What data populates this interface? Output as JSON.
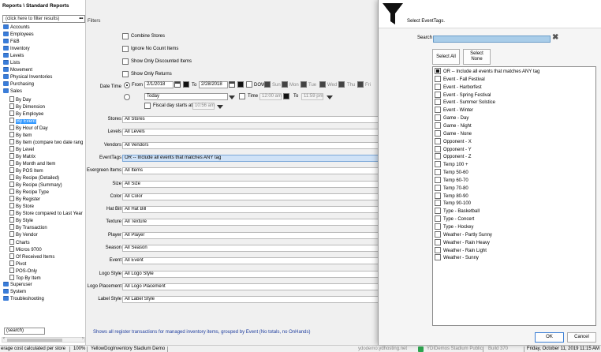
{
  "left_panel": {
    "breadcrumb": "Reports \\ Standard Reports",
    "filter_placeholder": "(click here to filter results)",
    "filter_more": "•••",
    "search_value": "(search)",
    "tree": [
      {
        "label": "Accounts",
        "type": "folder",
        "level": 0
      },
      {
        "label": "Employees",
        "type": "folder",
        "level": 0
      },
      {
        "label": "F&B",
        "type": "folder",
        "level": 0
      },
      {
        "label": "Inventory",
        "type": "folder",
        "level": 0
      },
      {
        "label": "Levels",
        "type": "folder",
        "level": 0
      },
      {
        "label": "Lists",
        "type": "folder",
        "level": 0
      },
      {
        "label": "Movement",
        "type": "folder",
        "level": 0
      },
      {
        "label": "Physical Inventories",
        "type": "folder",
        "level": 0
      },
      {
        "label": "Purchasing",
        "type": "folder",
        "level": 0
      },
      {
        "label": "Sales",
        "type": "folder",
        "level": 0
      },
      {
        "label": "By Day",
        "type": "doc",
        "level": 1
      },
      {
        "label": "By Dimension",
        "type": "doc",
        "level": 1
      },
      {
        "label": "By Employee",
        "type": "doc",
        "level": 1
      },
      {
        "label": "By Event",
        "type": "doc",
        "level": 1,
        "selected": true
      },
      {
        "label": "By Hour of Day",
        "type": "doc",
        "level": 1
      },
      {
        "label": "By Item",
        "type": "doc",
        "level": 1
      },
      {
        "label": "By Item (compare two date rang",
        "type": "doc",
        "level": 1
      },
      {
        "label": "By Level",
        "type": "doc",
        "level": 1
      },
      {
        "label": "By Matrix",
        "type": "doc",
        "level": 1
      },
      {
        "label": "By Month and Item",
        "type": "doc",
        "level": 1
      },
      {
        "label": "By POS Item",
        "type": "doc",
        "level": 1
      },
      {
        "label": "By Recipe (Detailed)",
        "type": "doc",
        "level": 1
      },
      {
        "label": "By Recipe (Summary)",
        "type": "doc",
        "level": 1
      },
      {
        "label": "By Recipe Type",
        "type": "doc",
        "level": 1
      },
      {
        "label": "By Register",
        "type": "doc",
        "level": 1
      },
      {
        "label": "By Store",
        "type": "doc",
        "level": 1
      },
      {
        "label": "By Store compared to Last Year",
        "type": "doc",
        "level": 1
      },
      {
        "label": "By Style",
        "type": "doc",
        "level": 1
      },
      {
        "label": "By Transaction",
        "type": "doc",
        "level": 1
      },
      {
        "label": "By Vendor",
        "type": "doc",
        "level": 1
      },
      {
        "label": "Charts",
        "type": "doc",
        "level": 1
      },
      {
        "label": "Micros 9700",
        "type": "doc",
        "level": 1
      },
      {
        "label": "Of Received Items",
        "type": "doc",
        "level": 1
      },
      {
        "label": "Pivot",
        "type": "doc",
        "level": 1
      },
      {
        "label": "POS-Only",
        "type": "doc",
        "level": 1
      },
      {
        "label": "Top By Item",
        "type": "doc",
        "level": 1
      },
      {
        "label": "Superuser",
        "type": "folder",
        "level": 0
      },
      {
        "label": "System",
        "type": "folder",
        "level": 0
      },
      {
        "label": "Troubleshooting",
        "type": "folder",
        "level": 0
      }
    ]
  },
  "filters": {
    "title": "Filters",
    "checkboxes": [
      "Combine Stores",
      "Ignore No Count Items",
      "Show Only Discounted Items",
      "Show Only Returns"
    ],
    "date_time_label": "Date Time",
    "from_label": "From",
    "from_date": "2/1/2018",
    "to_label": "To",
    "to_date": "2/28/2018",
    "dow_label": "DOW",
    "days": [
      "Sun",
      "Mon",
      "Tue",
      "Wed",
      "Thu",
      "Fri"
    ],
    "relative_value": "Today",
    "time_label": "Time",
    "time_from": "12:00 am",
    "time_to_label": "To",
    "time_to": "11:59 pm",
    "fiscal_label": "Fiscal day starts at",
    "fiscal_time": "10:56 am",
    "rows": [
      {
        "label": "Stores",
        "value": "All Stores"
      },
      {
        "label": "Levels",
        "value": "All Levels"
      },
      {
        "label": "Vendors",
        "value": "All Vendors"
      },
      {
        "label": "EventTags",
        "value": "OR -- Include all events that matches ANY tag",
        "highlight": true
      },
      {
        "label": "Evergreen Items",
        "value": "All Items"
      },
      {
        "label": "Size",
        "value": "All Size"
      },
      {
        "label": "Color",
        "value": "All Color"
      },
      {
        "label": "Hat Bill",
        "value": "All Hat Bill"
      },
      {
        "label": "Texture",
        "value": "All Texture"
      },
      {
        "label": "Player",
        "value": "All Player"
      },
      {
        "label": "Season",
        "value": "All Season"
      },
      {
        "label": "Event",
        "value": "All Event"
      },
      {
        "label": "Logo Style",
        "value": "All Logo Style"
      },
      {
        "label": "Logo Placement",
        "value": "All Logo Placement"
      },
      {
        "label": "Label Style",
        "value": "All Label Style"
      }
    ],
    "description": "Shows all register transactions for managed inventory items, grouped by Event (No totals, no OnHands)"
  },
  "dialog": {
    "title": "Select EventTags.",
    "search_label": "Search",
    "search_value": "",
    "select_all": "Select All",
    "select_none_1": "Select",
    "select_none_2": "None",
    "tags": [
      {
        "label": "OR -- Include all events that matches ANY tag",
        "checked": true
      },
      {
        "label": "Event - Fall Festival"
      },
      {
        "label": "Event - Harborfest"
      },
      {
        "label": "Event - Spring Festival"
      },
      {
        "label": "Event - Summer Solstice"
      },
      {
        "label": "Event - Winter"
      },
      {
        "label": "Game - Day"
      },
      {
        "label": "Game - Night"
      },
      {
        "label": "Game - None"
      },
      {
        "label": "Opponent - X"
      },
      {
        "label": "Opponent - Y"
      },
      {
        "label": "Opponent - Z"
      },
      {
        "label": "Temp 100 +"
      },
      {
        "label": "Temp 50-60"
      },
      {
        "label": "Temp 60-70"
      },
      {
        "label": "Temp 70-80"
      },
      {
        "label": "Temp 80-90"
      },
      {
        "label": "Temp 90-100"
      },
      {
        "label": "Type - Basketball"
      },
      {
        "label": "Type - Concert"
      },
      {
        "label": "Type - Hockey"
      },
      {
        "label": "Weather - Partly Sunny"
      },
      {
        "label": "Weather - Rain Heavy"
      },
      {
        "label": "Weather - Rain Light"
      },
      {
        "label": "Weather - Sunny"
      }
    ],
    "ok_label": "OK",
    "cancel_label": "Cancel"
  },
  "status_bar": {
    "cost_note": "erage cost calculated per store",
    "zoom": "100%",
    "database": "YellowDogInventory Stadium Demo",
    "host": "ydodemo.ydhosting.net",
    "site": "YDIDemos Stadium Public",
    "build": "Build 370",
    "datetime": "Friday, October 11, 2019 11:15 AM"
  },
  "colors": {
    "selection": "#3399ff",
    "search_fill": "#a9cde9",
    "description": "#1f3e9f"
  }
}
